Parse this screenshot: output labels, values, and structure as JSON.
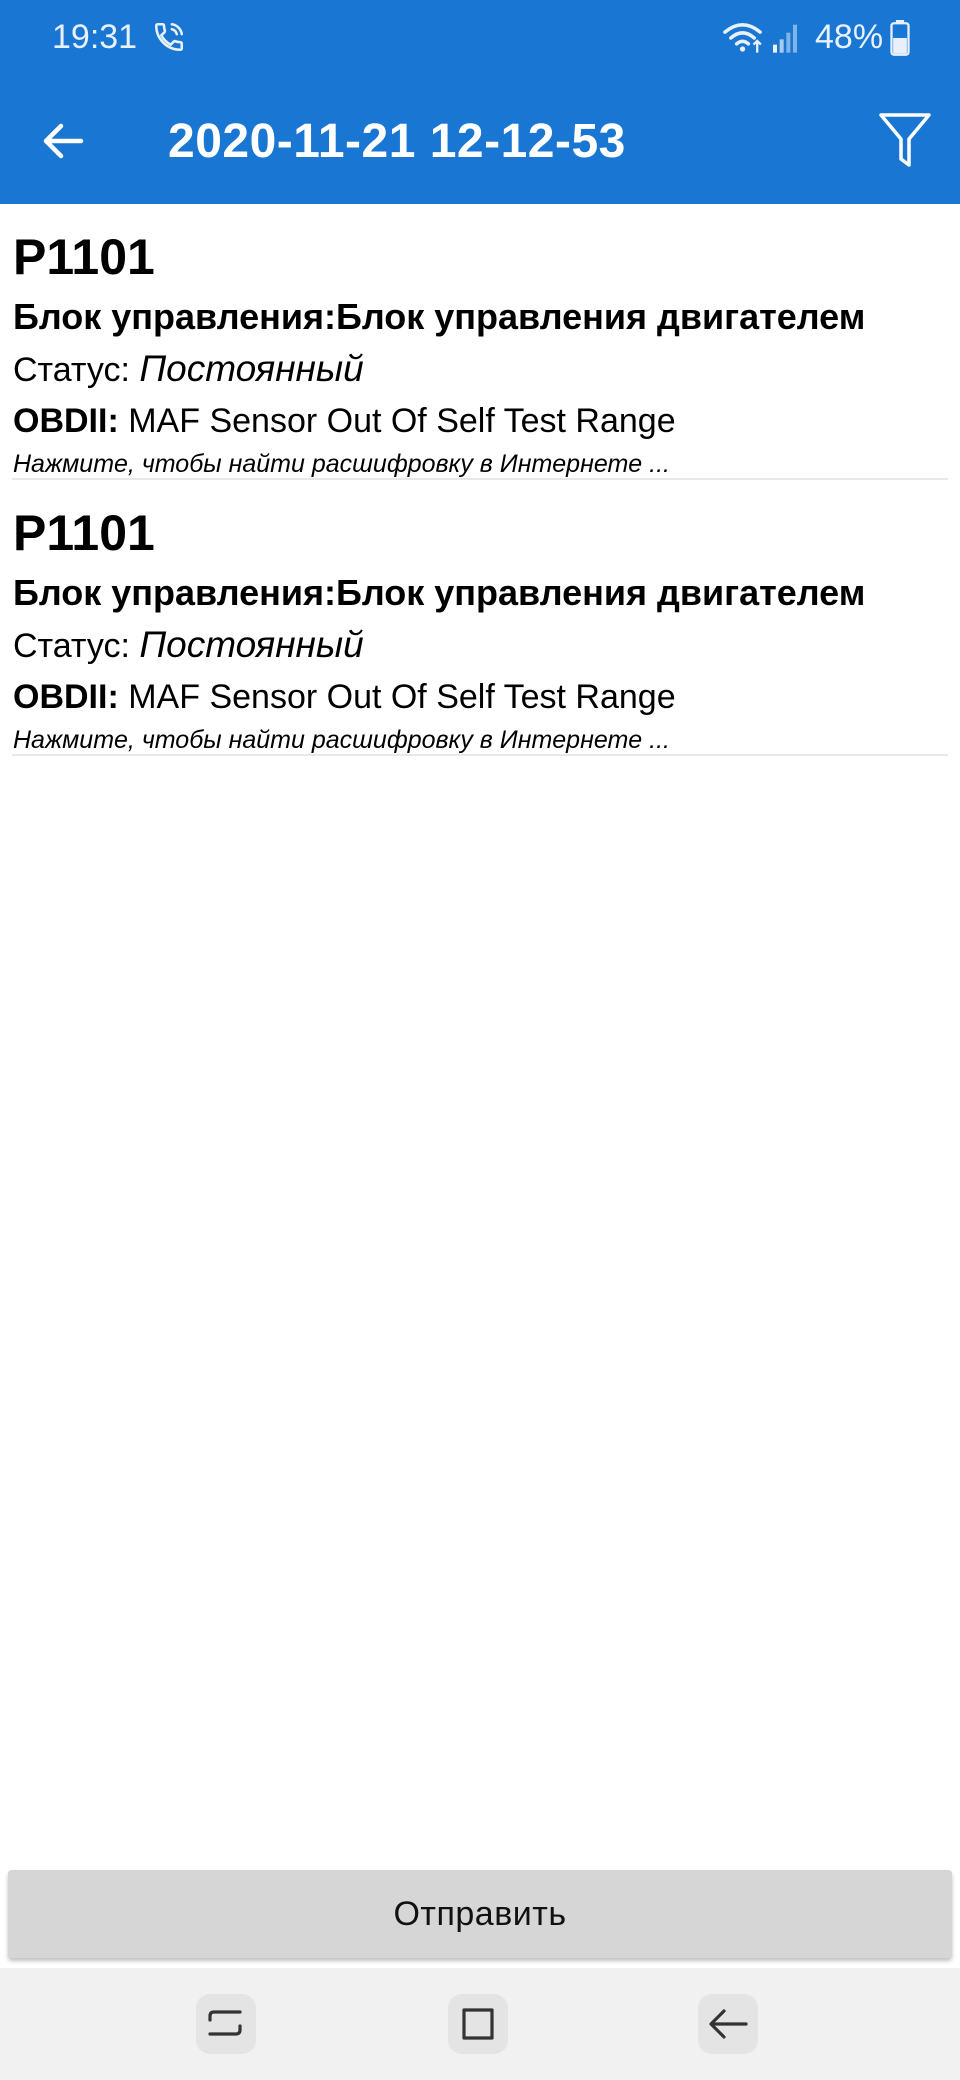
{
  "status_bar": {
    "time": "19:31",
    "battery": "48%",
    "icons": [
      "call-icon",
      "wifi-icon",
      "signal-icon",
      "battery-icon"
    ]
  },
  "app_bar": {
    "title": "2020-11-21 12-12-53",
    "back_icon": "arrow-left-icon",
    "filter_icon": "filter-icon",
    "color": "#1976d2"
  },
  "items": [
    {
      "code": "P1101",
      "block": "Блок управления:Блок управления двигателем",
      "status_label": "Статус: ",
      "status_value": "Постоянный",
      "obd_label": "OBDII:",
      "obd_value": " MAF Sensor Out Of Self Test Range",
      "hint": "Нажмите, чтобы найти расшифровку в Интернете ..."
    },
    {
      "code": "P1101",
      "block": "Блок управления:Блок управления двигателем",
      "status_label": "Статус: ",
      "status_value": "Постоянный",
      "obd_label": "OBDII:",
      "obd_value": " MAF Sensor Out Of Self Test Range",
      "hint": "Нажмите, чтобы найти расшифровку в Интернете ..."
    }
  ],
  "send_button": {
    "label": "Отправить"
  },
  "nav_bar": {
    "keys": [
      "recents-icon",
      "home-icon",
      "back-icon"
    ]
  }
}
